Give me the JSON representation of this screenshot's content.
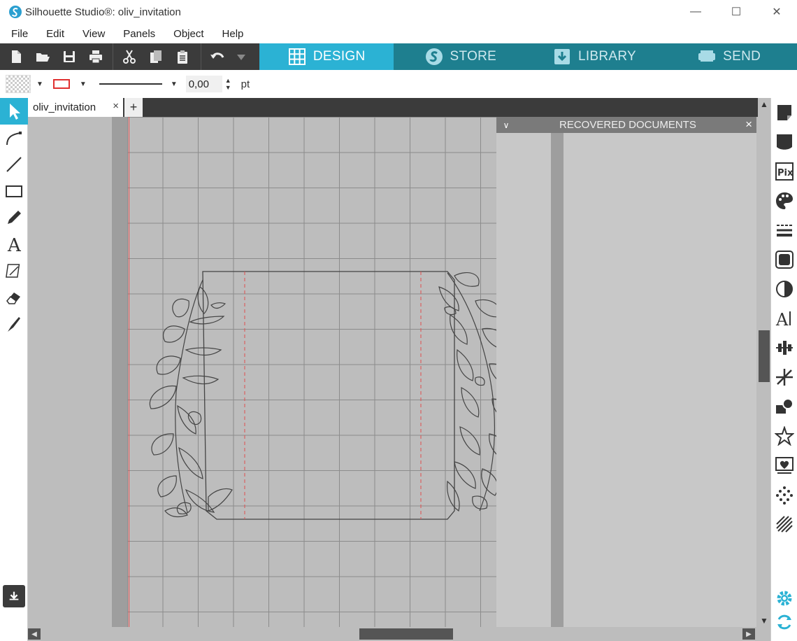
{
  "window": {
    "title": "Silhouette Studio®: oliv_invitation",
    "minimize": "—",
    "maximize": "☐",
    "close": "✕"
  },
  "menu": {
    "items": [
      "File",
      "Edit",
      "View",
      "Panels",
      "Object",
      "Help"
    ]
  },
  "nav_tabs": [
    {
      "label": "DESIGN",
      "icon": "grid-icon",
      "active": true
    },
    {
      "label": "STORE",
      "icon": "silhouette-s-icon",
      "active": false
    },
    {
      "label": "LIBRARY",
      "icon": "download-icon",
      "active": false
    },
    {
      "label": "SEND",
      "icon": "cutter-icon",
      "active": false
    }
  ],
  "line_settings": {
    "line_width_value": "0,00",
    "unit": "pt",
    "line_color": "#e03030"
  },
  "document": {
    "tab_label": "oliv_invitation",
    "tab_close": "×",
    "add_tab": "+"
  },
  "recovered_panel": {
    "title": "RECOVERED DOCUMENTS",
    "close": "×"
  },
  "colors": {
    "accent": "#2bb2d4",
    "nav_bg": "#1e7f8f",
    "toolbar_bg": "#3b3b3b",
    "mat_bg": "#bdbdbd",
    "cut_line": "#e05050"
  }
}
